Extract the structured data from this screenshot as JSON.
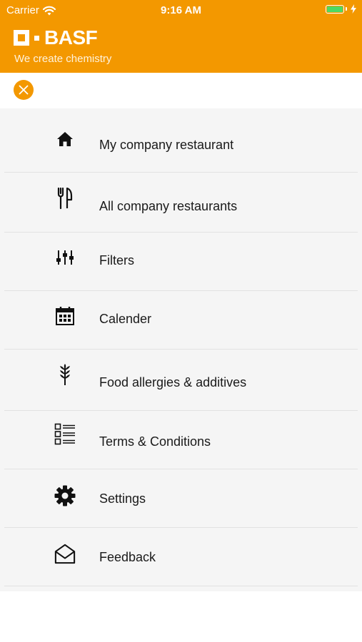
{
  "status_bar": {
    "carrier": "Carrier",
    "time": "9:16 AM",
    "battery_color": "#4CD964"
  },
  "brand": {
    "name": "BASF",
    "tagline": "We create chemistry",
    "color": "#F39800"
  },
  "close_button": {
    "icon": "close-icon"
  },
  "menu": {
    "items": [
      {
        "label": "My company restaurant",
        "icon": "home-icon"
      },
      {
        "label": "All company restaurants",
        "icon": "cutlery-icon"
      },
      {
        "label": "Filters",
        "icon": "sliders-icon"
      },
      {
        "label": "Calender",
        "icon": "calendar-icon"
      },
      {
        "label": "Food allergies & additives",
        "icon": "wheat-icon"
      },
      {
        "label": "Terms & Conditions",
        "icon": "checklist-icon"
      },
      {
        "label": "Settings",
        "icon": "gear-icon"
      },
      {
        "label": "Feedback",
        "icon": "envelope-icon"
      }
    ]
  }
}
